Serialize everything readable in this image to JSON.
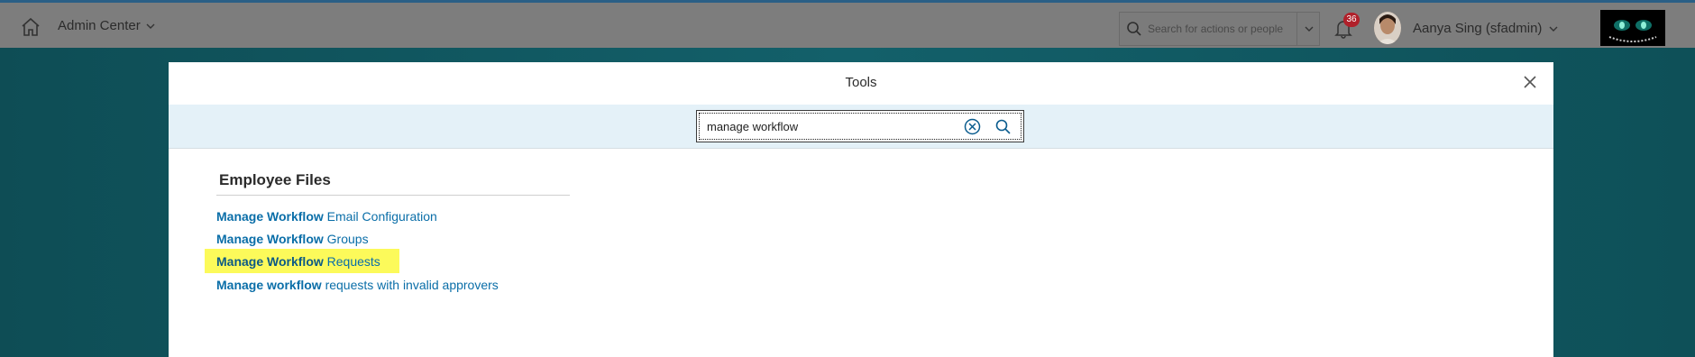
{
  "header": {
    "module_label": "Admin Center",
    "search_placeholder": "Search for actions or people",
    "notification_count": "36",
    "user_name": "Aanya Sing (sfadmin)"
  },
  "dialog": {
    "title": "Tools",
    "search_value": "manage workflow",
    "section_title": "Employee Files",
    "results": [
      {
        "bold": "Manage Workflow",
        "rest": " Email Configuration",
        "highlighted": false
      },
      {
        "bold": "Manage Workflow",
        "rest": " Groups",
        "highlighted": false
      },
      {
        "bold": "Manage Workflow",
        "rest": " Requests",
        "highlighted": true
      },
      {
        "bold": "Manage workflow",
        "rest": " requests with invalid approvers",
        "highlighted": false
      }
    ]
  },
  "colors": {
    "link": "#0a6ea8",
    "highlight": "#fcfa5a",
    "badge": "#b0202a",
    "filterbar": "#e4f1f8"
  },
  "icons": [
    "home-icon",
    "chevron-down-icon",
    "search-icon",
    "bell-icon",
    "close-icon",
    "clear-circle-icon"
  ]
}
